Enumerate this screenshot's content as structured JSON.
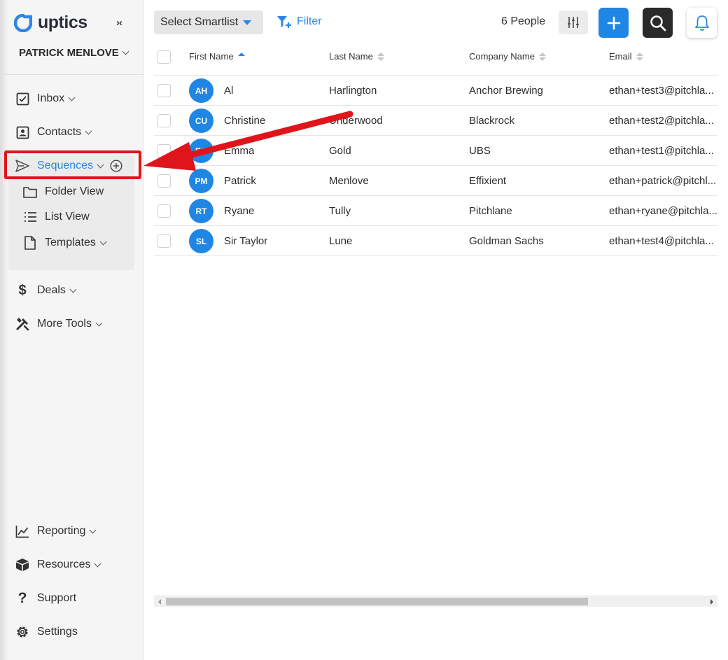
{
  "brand": {
    "name": "uptics",
    "accent": "#2d86e6",
    "annotation_color": "#e0141b"
  },
  "sidebar": {
    "collapse_icon": "collapse-arrows-icon",
    "user_name": "PATRICK MENLOVE",
    "items": [
      {
        "label": "Inbox",
        "icon": "inbox-icon"
      },
      {
        "label": "Contacts",
        "icon": "contacts-icon"
      },
      {
        "label": "Sequences",
        "icon": "paper-plane-icon",
        "active": true
      },
      {
        "label": "Deals",
        "icon": "dollar-icon"
      },
      {
        "label": "More Tools",
        "icon": "tools-icon"
      },
      {
        "label": "Reporting",
        "icon": "chart-icon"
      },
      {
        "label": "Resources",
        "icon": "box-icon"
      },
      {
        "label": "Support",
        "icon": "question-icon"
      },
      {
        "label": "Settings",
        "icon": "gear-icon"
      }
    ],
    "sequences_sub": [
      {
        "label": "Folder View",
        "icon": "folder-icon"
      },
      {
        "label": "List View",
        "icon": "list-icon"
      },
      {
        "label": "Templates",
        "icon": "document-icon"
      }
    ]
  },
  "toolbar": {
    "smartlist_label": "Select Smartlist",
    "filter_label": "Filter",
    "people_count": "6 People"
  },
  "table": {
    "columns": [
      "First Name",
      "Last Name",
      "Company Name",
      "Email"
    ],
    "sorted_column": "First Name",
    "sort_direction": "asc",
    "rows": [
      {
        "initials": "AH",
        "first": "Al",
        "last": "Harlington",
        "company": "Anchor Brewing",
        "email": "ethan+test3@pitchla..."
      },
      {
        "initials": "CU",
        "first": "Christine",
        "last": "Underwood",
        "company": "Blackrock",
        "email": "ethan+test2@pitchla..."
      },
      {
        "initials": "EG",
        "first": "Emma",
        "last": "Gold",
        "company": "UBS",
        "email": "ethan+test1@pitchla..."
      },
      {
        "initials": "PM",
        "first": "Patrick",
        "last": "Menlove",
        "company": "Effixient",
        "email": "ethan+patrick@pitchl..."
      },
      {
        "initials": "RT",
        "first": "Ryane",
        "last": "Tully",
        "company": "Pitchlane",
        "email": "ethan+ryane@pitchla..."
      },
      {
        "initials": "SL",
        "first": "Sir Taylor",
        "last": "Lune",
        "company": "Goldman Sachs",
        "email": "ethan+test4@pitchla..."
      }
    ]
  }
}
